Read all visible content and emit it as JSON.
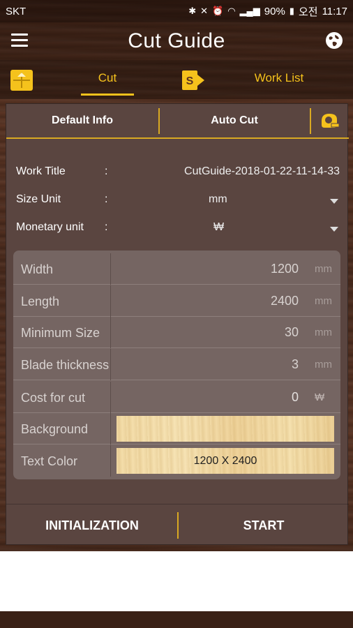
{
  "status_bar": {
    "carrier": "SKT",
    "battery": "90%",
    "time_prefix": "오전",
    "time": "11:17"
  },
  "app_bar": {
    "title": "Cut Guide",
    "menu_icon": "hamburger-menu-icon",
    "globe_icon": "globe-icon"
  },
  "tabs": {
    "cut_label": "Cut",
    "work_list_label": "Work List",
    "accent_color": "#f5c21c"
  },
  "subtabs": {
    "default_info": "Default Info",
    "auto_cut": "Auto Cut"
  },
  "info": {
    "work_title_label": "Work Title",
    "work_title_value": "CutGuide-2018-01-22-11-14-33",
    "size_unit_label": "Size Unit",
    "size_unit_value": "mm",
    "monetary_label": "Monetary unit",
    "monetary_value": "₩",
    "colon": ":"
  },
  "grid": {
    "rows": [
      {
        "label": "Width",
        "value": "1200",
        "unit": "mm"
      },
      {
        "label": "Length",
        "value": "2400",
        "unit": "mm"
      },
      {
        "label": "Minimum Size",
        "value": "30",
        "unit": "mm"
      },
      {
        "label": "Blade thickness",
        "value": "3",
        "unit": "mm"
      },
      {
        "label": "Cost for cut",
        "value": "0",
        "unit": "₩"
      }
    ],
    "background_label": "Background",
    "text_color_label": "Text Color",
    "text_color_preview": "1200 X 2400"
  },
  "buttons": {
    "initialization": "INITIALIZATION",
    "start": "START"
  }
}
